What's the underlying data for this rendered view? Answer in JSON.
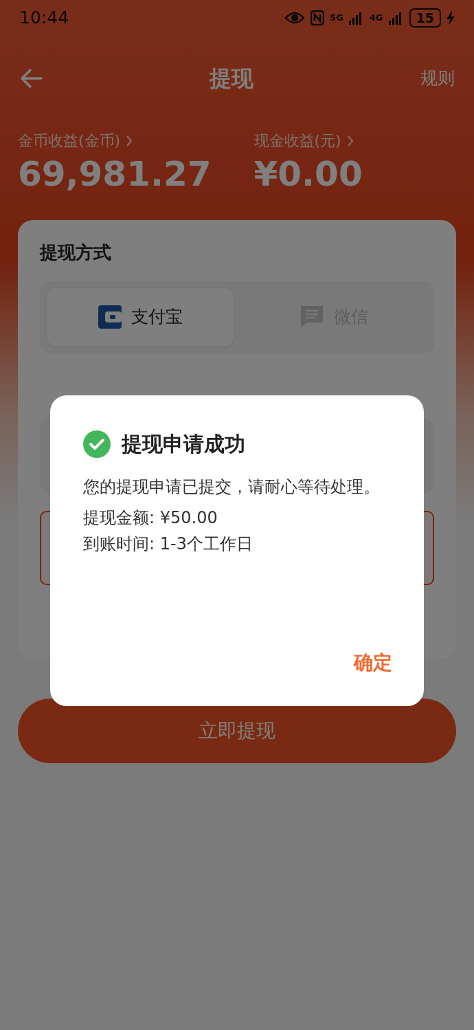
{
  "status_bar": {
    "time": "10:44",
    "network_1": "5G",
    "network_2": "4G",
    "battery": "15"
  },
  "header": {
    "title": "提现",
    "rules_link": "规则"
  },
  "balances": [
    {
      "label": "金币收益(金币)",
      "value": "69,981.27"
    },
    {
      "label": "现金收益(元)",
      "value": "¥0.00"
    }
  ],
  "withdraw_card": {
    "title": "提现方式",
    "methods": [
      {
        "label": "支付宝",
        "kind": "alipay",
        "selected": true
      },
      {
        "label": "微信",
        "kind": "wechat",
        "selected": false
      }
    ]
  },
  "submit_button": "立即提现",
  "dialog": {
    "title": "提现申请成功",
    "message": "您的提现申请已提交，请耐心等待处理。",
    "details": [
      "提现金额: ¥50.00",
      "到账时间: 1-3个工作日"
    ],
    "confirm": "确定"
  }
}
